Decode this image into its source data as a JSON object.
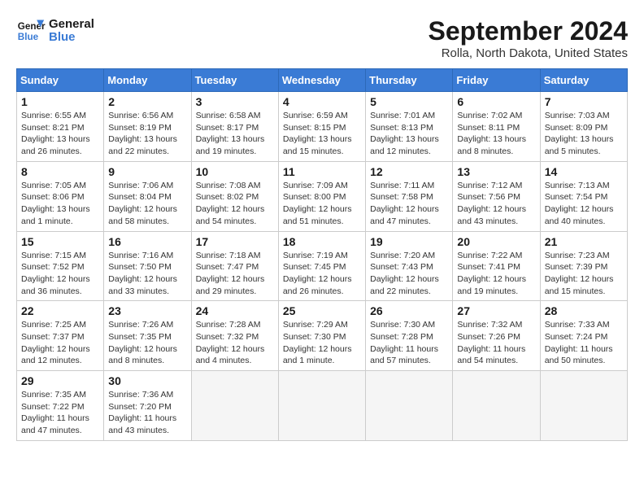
{
  "header": {
    "logo_line1": "General",
    "logo_line2": "Blue",
    "month_title": "September 2024",
    "location": "Rolla, North Dakota, United States"
  },
  "weekdays": [
    "Sunday",
    "Monday",
    "Tuesday",
    "Wednesday",
    "Thursday",
    "Friday",
    "Saturday"
  ],
  "weeks": [
    [
      {
        "day": 1,
        "info": "Sunrise: 6:55 AM\nSunset: 8:21 PM\nDaylight: 13 hours\nand 26 minutes."
      },
      {
        "day": 2,
        "info": "Sunrise: 6:56 AM\nSunset: 8:19 PM\nDaylight: 13 hours\nand 22 minutes."
      },
      {
        "day": 3,
        "info": "Sunrise: 6:58 AM\nSunset: 8:17 PM\nDaylight: 13 hours\nand 19 minutes."
      },
      {
        "day": 4,
        "info": "Sunrise: 6:59 AM\nSunset: 8:15 PM\nDaylight: 13 hours\nand 15 minutes."
      },
      {
        "day": 5,
        "info": "Sunrise: 7:01 AM\nSunset: 8:13 PM\nDaylight: 13 hours\nand 12 minutes."
      },
      {
        "day": 6,
        "info": "Sunrise: 7:02 AM\nSunset: 8:11 PM\nDaylight: 13 hours\nand 8 minutes."
      },
      {
        "day": 7,
        "info": "Sunrise: 7:03 AM\nSunset: 8:09 PM\nDaylight: 13 hours\nand 5 minutes."
      }
    ],
    [
      {
        "day": 8,
        "info": "Sunrise: 7:05 AM\nSunset: 8:06 PM\nDaylight: 13 hours\nand 1 minute."
      },
      {
        "day": 9,
        "info": "Sunrise: 7:06 AM\nSunset: 8:04 PM\nDaylight: 12 hours\nand 58 minutes."
      },
      {
        "day": 10,
        "info": "Sunrise: 7:08 AM\nSunset: 8:02 PM\nDaylight: 12 hours\nand 54 minutes."
      },
      {
        "day": 11,
        "info": "Sunrise: 7:09 AM\nSunset: 8:00 PM\nDaylight: 12 hours\nand 51 minutes."
      },
      {
        "day": 12,
        "info": "Sunrise: 7:11 AM\nSunset: 7:58 PM\nDaylight: 12 hours\nand 47 minutes."
      },
      {
        "day": 13,
        "info": "Sunrise: 7:12 AM\nSunset: 7:56 PM\nDaylight: 12 hours\nand 43 minutes."
      },
      {
        "day": 14,
        "info": "Sunrise: 7:13 AM\nSunset: 7:54 PM\nDaylight: 12 hours\nand 40 minutes."
      }
    ],
    [
      {
        "day": 15,
        "info": "Sunrise: 7:15 AM\nSunset: 7:52 PM\nDaylight: 12 hours\nand 36 minutes."
      },
      {
        "day": 16,
        "info": "Sunrise: 7:16 AM\nSunset: 7:50 PM\nDaylight: 12 hours\nand 33 minutes."
      },
      {
        "day": 17,
        "info": "Sunrise: 7:18 AM\nSunset: 7:47 PM\nDaylight: 12 hours\nand 29 minutes."
      },
      {
        "day": 18,
        "info": "Sunrise: 7:19 AM\nSunset: 7:45 PM\nDaylight: 12 hours\nand 26 minutes."
      },
      {
        "day": 19,
        "info": "Sunrise: 7:20 AM\nSunset: 7:43 PM\nDaylight: 12 hours\nand 22 minutes."
      },
      {
        "day": 20,
        "info": "Sunrise: 7:22 AM\nSunset: 7:41 PM\nDaylight: 12 hours\nand 19 minutes."
      },
      {
        "day": 21,
        "info": "Sunrise: 7:23 AM\nSunset: 7:39 PM\nDaylight: 12 hours\nand 15 minutes."
      }
    ],
    [
      {
        "day": 22,
        "info": "Sunrise: 7:25 AM\nSunset: 7:37 PM\nDaylight: 12 hours\nand 12 minutes."
      },
      {
        "day": 23,
        "info": "Sunrise: 7:26 AM\nSunset: 7:35 PM\nDaylight: 12 hours\nand 8 minutes."
      },
      {
        "day": 24,
        "info": "Sunrise: 7:28 AM\nSunset: 7:32 PM\nDaylight: 12 hours\nand 4 minutes."
      },
      {
        "day": 25,
        "info": "Sunrise: 7:29 AM\nSunset: 7:30 PM\nDaylight: 12 hours\nand 1 minute."
      },
      {
        "day": 26,
        "info": "Sunrise: 7:30 AM\nSunset: 7:28 PM\nDaylight: 11 hours\nand 57 minutes."
      },
      {
        "day": 27,
        "info": "Sunrise: 7:32 AM\nSunset: 7:26 PM\nDaylight: 11 hours\nand 54 minutes."
      },
      {
        "day": 28,
        "info": "Sunrise: 7:33 AM\nSunset: 7:24 PM\nDaylight: 11 hours\nand 50 minutes."
      }
    ],
    [
      {
        "day": 29,
        "info": "Sunrise: 7:35 AM\nSunset: 7:22 PM\nDaylight: 11 hours\nand 47 minutes."
      },
      {
        "day": 30,
        "info": "Sunrise: 7:36 AM\nSunset: 7:20 PM\nDaylight: 11 hours\nand 43 minutes."
      },
      null,
      null,
      null,
      null,
      null
    ]
  ]
}
